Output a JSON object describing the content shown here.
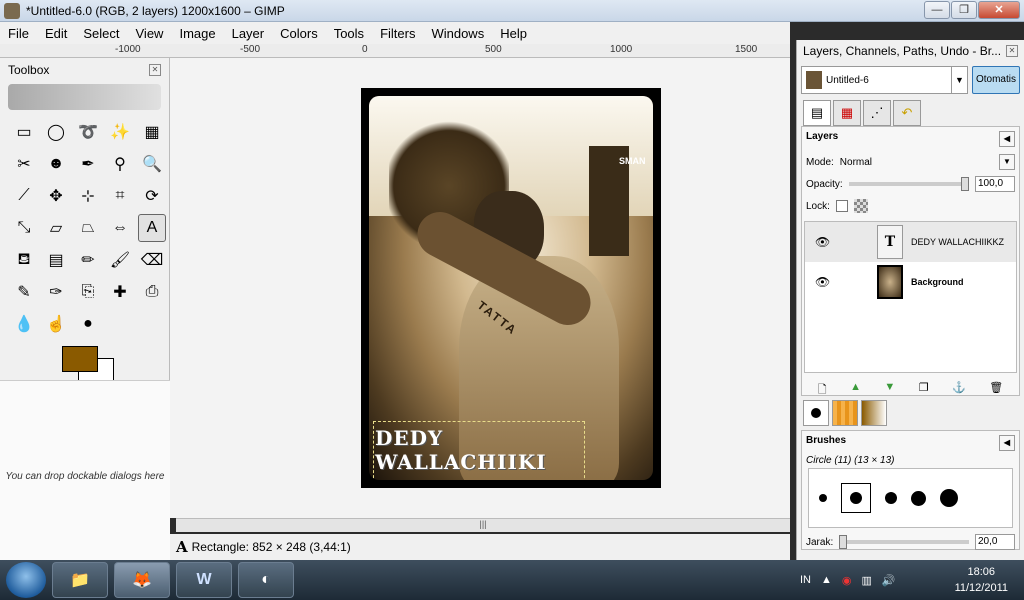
{
  "window": {
    "title": "*Untitled-6.0 (RGB, 2 layers) 1200x1600 – GIMP",
    "minimize": "—",
    "maximize": "❐",
    "close": "✕"
  },
  "menu": [
    "File",
    "Edit",
    "Select",
    "View",
    "Image",
    "Layer",
    "Colors",
    "Tools",
    "Filters",
    "Windows",
    "Help"
  ],
  "ruler": {
    "ticks": [
      "-1000",
      "-500",
      "0",
      "500",
      "1000",
      "1500"
    ]
  },
  "canvas": {
    "overlay_text": "DEDY\nWALLACHIIKI",
    "tattoo_text": "TATTA",
    "gate_text": "SMAN"
  },
  "status": {
    "icon": "A",
    "text": "Rectangle: 852 × 248  (3,44:1)"
  },
  "toolbox": {
    "title": "Toolbox",
    "drop_note": "You can drop dockable dialogs here",
    "fg_color": "#8a5a00",
    "bg_color": "#ffffff"
  },
  "dock": {
    "title": "Layers, Channels, Paths, Undo - Br...",
    "image_select": "Untitled-6",
    "auto_button": "Otomatis",
    "layers": {
      "header": "Layers",
      "mode_label": "Mode:",
      "mode_value": "Normal",
      "opacity_label": "Opacity:",
      "opacity_value": "100,0",
      "opacity_fraction": 1.0,
      "lock_label": "Lock:",
      "items": [
        {
          "name": "DEDY WALLACHIIKKZ",
          "thumb": "T",
          "selected": true
        },
        {
          "name": "Background",
          "thumb": "",
          "selected": false
        }
      ]
    },
    "brushes": {
      "header": "Brushes",
      "current": "Circle (11) (13 × 13)",
      "spacing_label": "Jarak:",
      "spacing_value": "20,0"
    }
  },
  "taskbar": {
    "lang": "IN",
    "time": "18:06",
    "date": "11/12/2011"
  }
}
